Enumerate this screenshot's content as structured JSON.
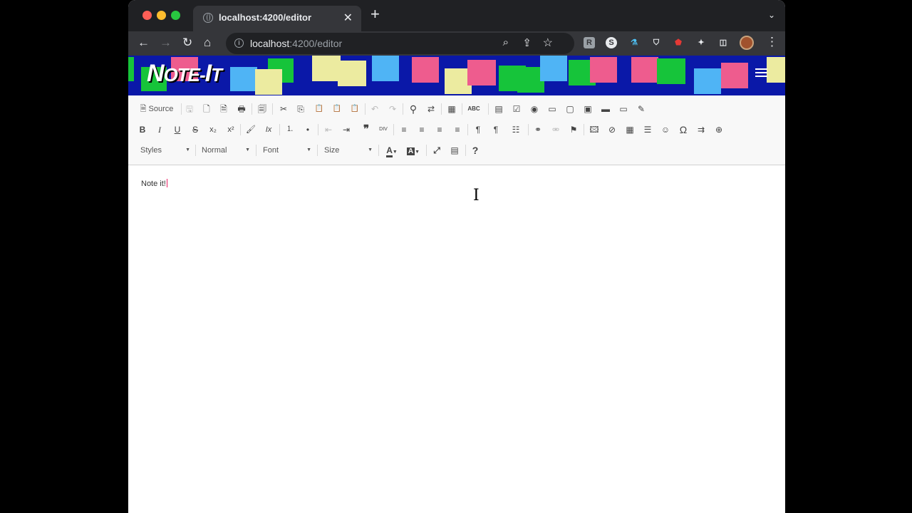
{
  "browser": {
    "tab_title": "localhost:4200/editor",
    "tab_close": "✕",
    "new_tab": "+",
    "tab_search": "⌄",
    "back": "←",
    "forward": "→",
    "reload": "↻",
    "home": "⌂",
    "url_host": "localhost",
    "url_path": ":4200/editor",
    "zoom": "⌕",
    "share": "⇪",
    "star": "☆",
    "extensions": [
      "R",
      "S",
      "⚗",
      "⛉",
      "⬟",
      "✦",
      "◫"
    ],
    "menu": "⋮"
  },
  "app": {
    "logo_main": "N",
    "logo_rest": "OTE-",
    "logo_i": "I",
    "logo_t": "T"
  },
  "editor": {
    "source_label": "Source",
    "row1": [
      "🖫",
      "🗋",
      "🗎",
      "🖶",
      "🗐",
      "✂",
      "⎘",
      "📋",
      "📋",
      "📋",
      "↶",
      "↷",
      "⚲",
      "⇄",
      "▦",
      "ABC",
      "▤",
      "☑",
      "◉",
      "▭",
      "▢",
      "▣",
      "▬",
      "▭",
      "✎"
    ],
    "row2": [
      "B",
      "I",
      "U",
      "S",
      "x₂",
      "x²",
      "🖌",
      "Ix",
      "⒈",
      "•",
      "⇤",
      "⇥",
      "❞",
      "DIV",
      "≡",
      "≡",
      "≡",
      "≡",
      "¶",
      "¶",
      "☷",
      "⚭",
      "⚮",
      "⚑",
      "🖾",
      "⊘",
      "▦",
      "☰",
      "☺",
      "Ω",
      "⇉",
      "⊕"
    ],
    "row3": {
      "styles": "Styles",
      "format": "Normal",
      "font": "Font",
      "size": "Size",
      "text_color": "A",
      "bg_color": "A",
      "maximize": "⤢",
      "blocks": "▤",
      "help": "?"
    },
    "content_text": "Note it!"
  },
  "colors": {
    "banner_bg": "#0a18a8",
    "note_pink": "#ee5c8e",
    "note_yellow": "#eceba0",
    "note_blue": "#4fb4f5",
    "note_green": "#16c43a"
  }
}
